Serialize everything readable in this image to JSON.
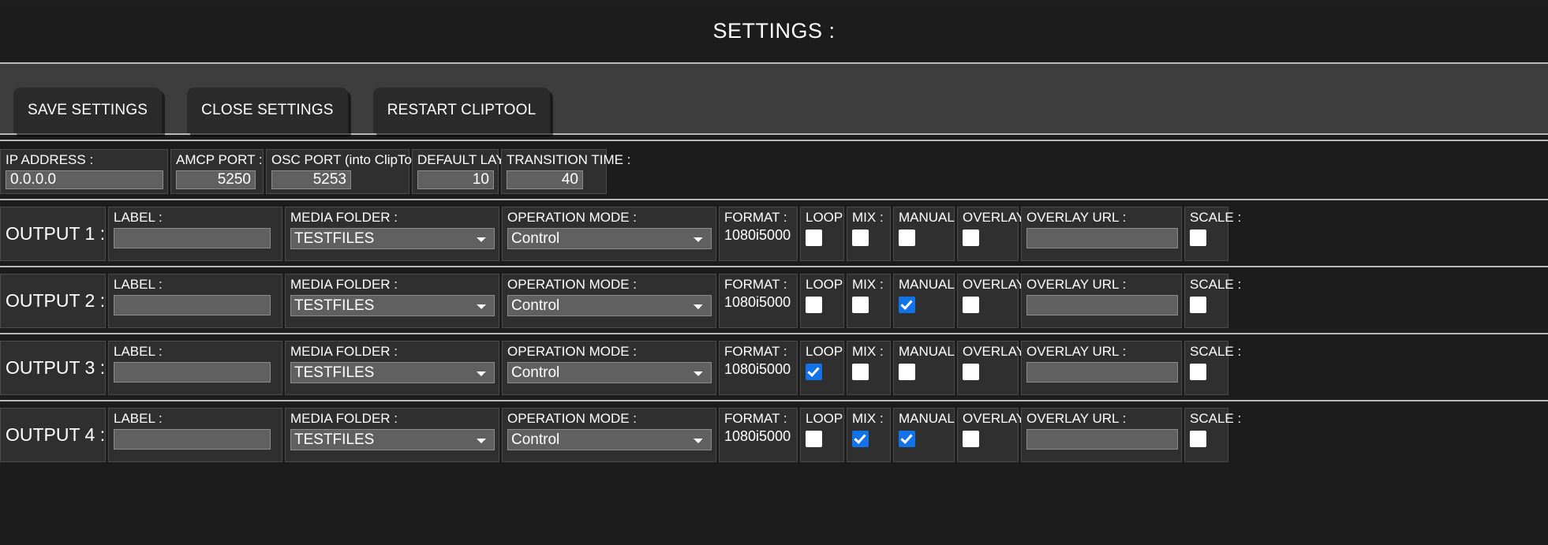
{
  "header": {
    "title": "SETTINGS :"
  },
  "toolbar": {
    "save_label": "SAVE SETTINGS",
    "close_label": "CLOSE SETTINGS",
    "restart_label": "RESTART CLIPTOOL"
  },
  "network": {
    "ip_address": {
      "label": "IP ADDRESS :",
      "value": "0.0.0.0"
    },
    "amcp_port": {
      "label": "AMCP PORT :",
      "value": "5250"
    },
    "osc_port": {
      "label": "OSC PORT (into ClipTool) :",
      "value": "5253"
    },
    "default_layer": {
      "label": "DEFAULT LAYER :",
      "value": "10"
    },
    "transition_time": {
      "label": "TRANSITION TIME :",
      "value": "40"
    }
  },
  "columns": {
    "label": "LABEL :",
    "media_folder": "MEDIA FOLDER :",
    "operation_mode": "OPERATION MODE :",
    "format": "FORMAT :",
    "loop": "LOOP :",
    "mix": "MIX :",
    "manual": "MANUAL :",
    "overlay": "OVERLAY :",
    "overlay_url": "OVERLAY URL :",
    "scale": "SCALE :"
  },
  "options": {
    "media_folder": [
      "TESTFILES"
    ],
    "operation_mode": [
      "Control"
    ]
  },
  "outputs": [
    {
      "name": "OUTPUT 1 :",
      "label_value": "",
      "media_folder": "TESTFILES",
      "operation_mode": "Control",
      "format": "1080i5000",
      "loop": false,
      "mix": false,
      "manual": false,
      "overlay": false,
      "overlay_url": "",
      "scale": false
    },
    {
      "name": "OUTPUT 2 :",
      "label_value": "",
      "media_folder": "TESTFILES",
      "operation_mode": "Control",
      "format": "1080i5000",
      "loop": false,
      "mix": false,
      "manual": true,
      "overlay": false,
      "overlay_url": "",
      "scale": false
    },
    {
      "name": "OUTPUT 3 :",
      "label_value": "",
      "media_folder": "TESTFILES",
      "operation_mode": "Control",
      "format": "1080i5000",
      "loop": true,
      "mix": false,
      "manual": false,
      "overlay": false,
      "overlay_url": "",
      "scale": false
    },
    {
      "name": "OUTPUT 4 :",
      "label_value": "",
      "media_folder": "TESTFILES",
      "operation_mode": "Control",
      "format": "1080i5000",
      "loop": false,
      "mix": true,
      "manual": true,
      "overlay": false,
      "overlay_url": "",
      "scale": false
    }
  ],
  "colors": {
    "accent_checked": "#1272e8",
    "page_background": "#1c1c1c",
    "toolbar_background": "#3d3d3d",
    "cell_background": "#2f2f2f",
    "input_background": "#606060",
    "divider": "#b9b9b9"
  }
}
